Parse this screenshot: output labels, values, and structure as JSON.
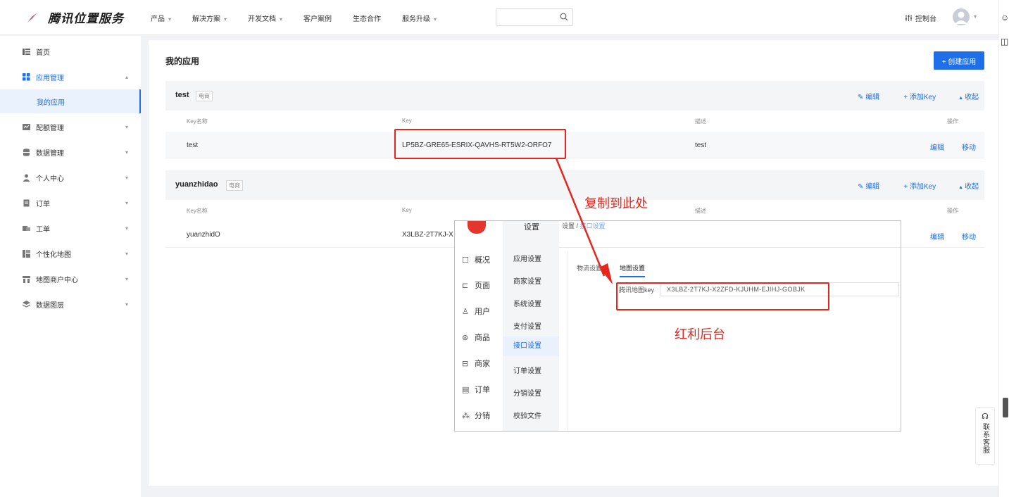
{
  "brand": {
    "title": "腾讯位置服务"
  },
  "nav": [
    {
      "label": "产品",
      "caret": "▾"
    },
    {
      "label": "解决方案",
      "caret": "▾"
    },
    {
      "label": "开发文档",
      "caret": "▾"
    },
    {
      "label": "客户案例",
      "caret": ""
    },
    {
      "label": "生态合作",
      "caret": ""
    },
    {
      "label": "服务升级",
      "caret": "▾"
    }
  ],
  "search": {
    "placeholder": ""
  },
  "header": {
    "console_label": "控制台"
  },
  "sidebar": {
    "items": [
      {
        "label": "首页",
        "icon": "home-list-icon"
      },
      {
        "label": "应用管理",
        "icon": "app-grid-icon"
      },
      {
        "label": "我的应用"
      },
      {
        "label": "配额管理",
        "icon": "quota-icon"
      },
      {
        "label": "数据管理",
        "icon": "database-icon"
      },
      {
        "label": "个人中心",
        "icon": "user-icon"
      },
      {
        "label": "订单",
        "icon": "order-icon"
      },
      {
        "label": "工单",
        "icon": "ticket-icon"
      },
      {
        "label": "个性化地图",
        "icon": "custom-map-icon"
      },
      {
        "label": "地图商户中心",
        "icon": "merchant-icon"
      },
      {
        "label": "数据图层",
        "icon": "layers-icon"
      }
    ]
  },
  "main": {
    "title": "我的应用",
    "create_button": "+ 创建应用",
    "columns": {
      "key_name": "Key名称",
      "key": "Key",
      "desc": "描述",
      "ops": "操作"
    },
    "actions": {
      "edit": "编辑",
      "add_key": "+ 添加Key",
      "collapse": "收起"
    },
    "row_ops": {
      "edit": "编辑",
      "move": "移动"
    },
    "apps": [
      {
        "name": "test",
        "tag": "电商",
        "rows": [
          {
            "key_name": "test",
            "key": "LP5BZ-GRE65-ESRIX-QAVHS-RT5W2-ORFO7",
            "desc": "test"
          }
        ]
      },
      {
        "name": "yuanzhidao",
        "tag": "电商",
        "rows": [
          {
            "key_name": "yuanzhidO",
            "key": "X3LBZ-2T7KJ-X",
            "desc": ""
          }
        ]
      }
    ]
  },
  "annotations": {
    "copy_here": "复制到此处",
    "backend": "红利后台"
  },
  "overlay": {
    "nav": [
      {
        "label": "概况",
        "icon": "☐"
      },
      {
        "label": "页面",
        "icon": "⊏"
      },
      {
        "label": "用户",
        "icon": "♙"
      },
      {
        "label": "商品",
        "icon": "⊛"
      },
      {
        "label": "商家",
        "icon": "⊟"
      },
      {
        "label": "订单",
        "icon": "▤"
      },
      {
        "label": "分销",
        "icon": "⁂"
      }
    ],
    "section_title": "设置",
    "breadcrumb": {
      "first": "设置",
      "second": "接口设置"
    },
    "sub": [
      "应用设置",
      "商家设置",
      "系统设置",
      "支付设置",
      "接口设置",
      "订单设置",
      "分销设置",
      "校验文件"
    ],
    "tabs": [
      "物流设置",
      "地图设置"
    ],
    "field_label": "腾讯地图key",
    "field_value": "X3LBZ-2T7KJ-X2ZFD-KJUHM-EJIHJ-GOBJK"
  },
  "contact": {
    "label": "联系客服"
  },
  "colors": {
    "accent": "#1e6fe8",
    "annotation": "#e8251c",
    "brand_red": "#e4362c"
  }
}
